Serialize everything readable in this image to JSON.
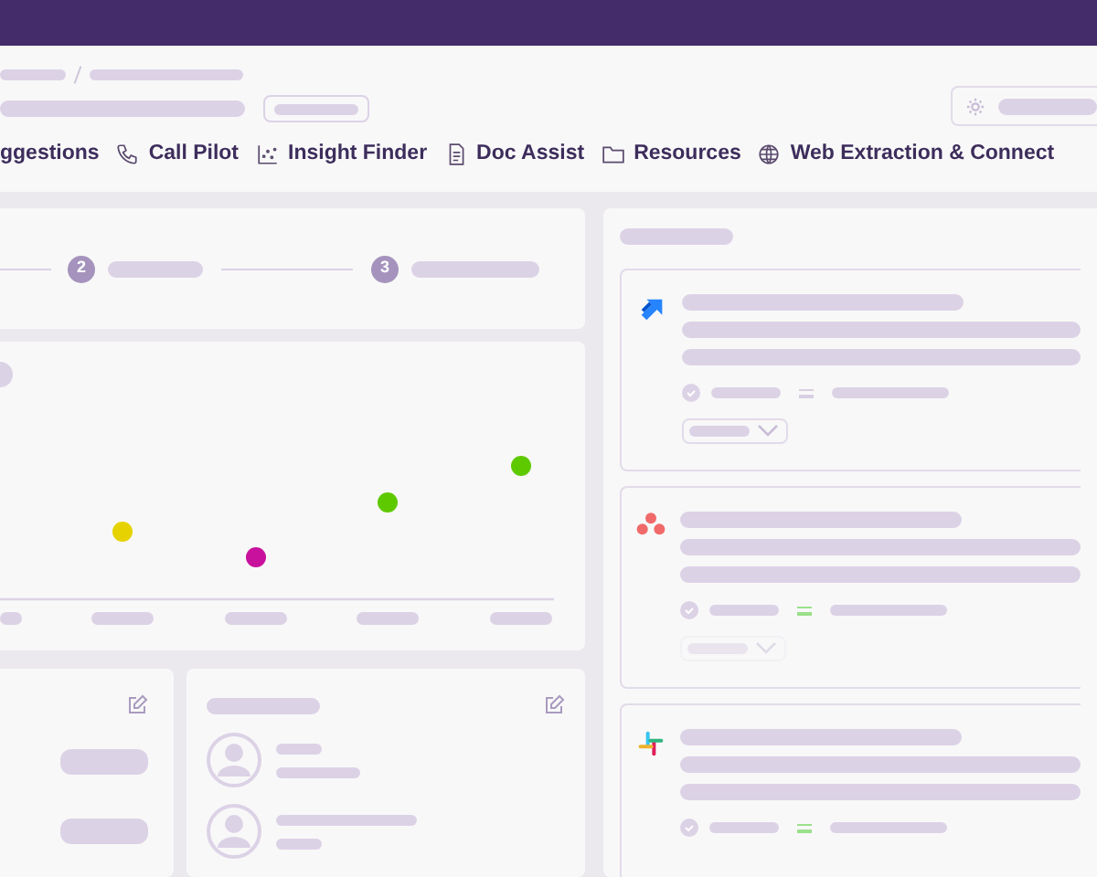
{
  "nav_tabs": [
    {
      "label": "ggestions",
      "kind": "plain"
    },
    {
      "label": "Call Pilot",
      "kind": "phone"
    },
    {
      "label": "Insight Finder",
      "kind": "scatter"
    },
    {
      "label": "Doc Assist",
      "kind": "document"
    },
    {
      "label": "Resources",
      "kind": "folder"
    },
    {
      "label": "Web Extraction & Connect",
      "kind": "globe"
    }
  ],
  "stepper": {
    "steps": [
      {
        "number": "2"
      },
      {
        "number": "3"
      }
    ]
  },
  "integrations": [
    {
      "kind": "chevrons",
      "linked": false,
      "dropdown": {
        "disabled": false
      }
    },
    {
      "kind": "dots",
      "linked": true,
      "dropdown": {
        "disabled": true
      }
    },
    {
      "kind": "hash",
      "linked": true
    }
  ]
}
